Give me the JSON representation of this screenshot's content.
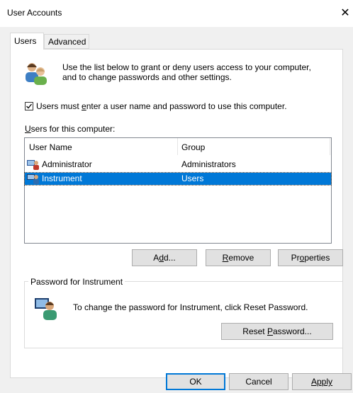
{
  "window": {
    "title": "User Accounts",
    "close_glyph": "✕"
  },
  "tabs": [
    {
      "label": "Users",
      "selected": true
    },
    {
      "label": "Advanced",
      "selected": false
    }
  ],
  "intro": {
    "icon": "users-icon",
    "line1": "Use the list below to grant or deny users access to your computer,",
    "line2": "and to change passwords and other settings."
  },
  "login_required": {
    "checked": true,
    "label_pre": "Users must ",
    "label_key": "e",
    "label_post": "nter a user name and password to use this computer."
  },
  "users_list": {
    "label_key": "U",
    "label_post": "sers for this computer:",
    "columns": [
      "User Name",
      "Group"
    ],
    "rows": [
      {
        "name": "Administrator",
        "group": "Administrators",
        "selected": false
      },
      {
        "name": "Instrument",
        "group": "Users",
        "selected": true
      }
    ]
  },
  "list_buttons": {
    "add_pre": "A",
    "add_key": "d",
    "add_post": "d...",
    "remove_key": "R",
    "remove_post": "emove",
    "props_pre": "Pr",
    "props_key": "o",
    "props_post": "perties"
  },
  "password_group": {
    "legend": "Password for Instrument",
    "text": "To change the password for Instrument, click Reset Password.",
    "reset_pre": "Reset ",
    "reset_key": "P",
    "reset_post": "assword..."
  },
  "dialog_buttons": {
    "ok": "OK",
    "cancel": "Cancel",
    "apply": "Apply"
  },
  "colors": {
    "selection": "#0078d7",
    "default_button_border": "#0078d7"
  }
}
